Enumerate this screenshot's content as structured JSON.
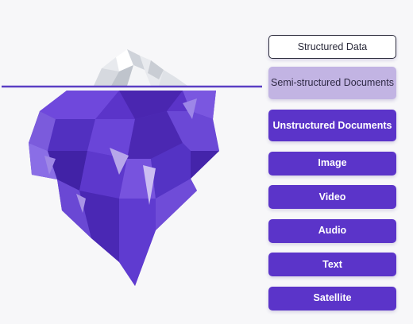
{
  "layers": [
    {
      "label": "Structured Data"
    },
    {
      "label": "Semi-structured Documents"
    },
    {
      "label": "Unstructured Documents"
    },
    {
      "label": "Image"
    },
    {
      "label": "Video"
    },
    {
      "label": "Audio"
    },
    {
      "label": "Text"
    },
    {
      "label": "Satellite"
    }
  ],
  "colors": {
    "background": "#f7f7f9",
    "tip_label_border": "#2b2b3b",
    "semi_label": "#c2b4e3",
    "deep_label": "#5b34c9",
    "waterline": "#5a3fc4",
    "ice_tip": "#e9ecef",
    "ice_body": "#5b34c9"
  }
}
